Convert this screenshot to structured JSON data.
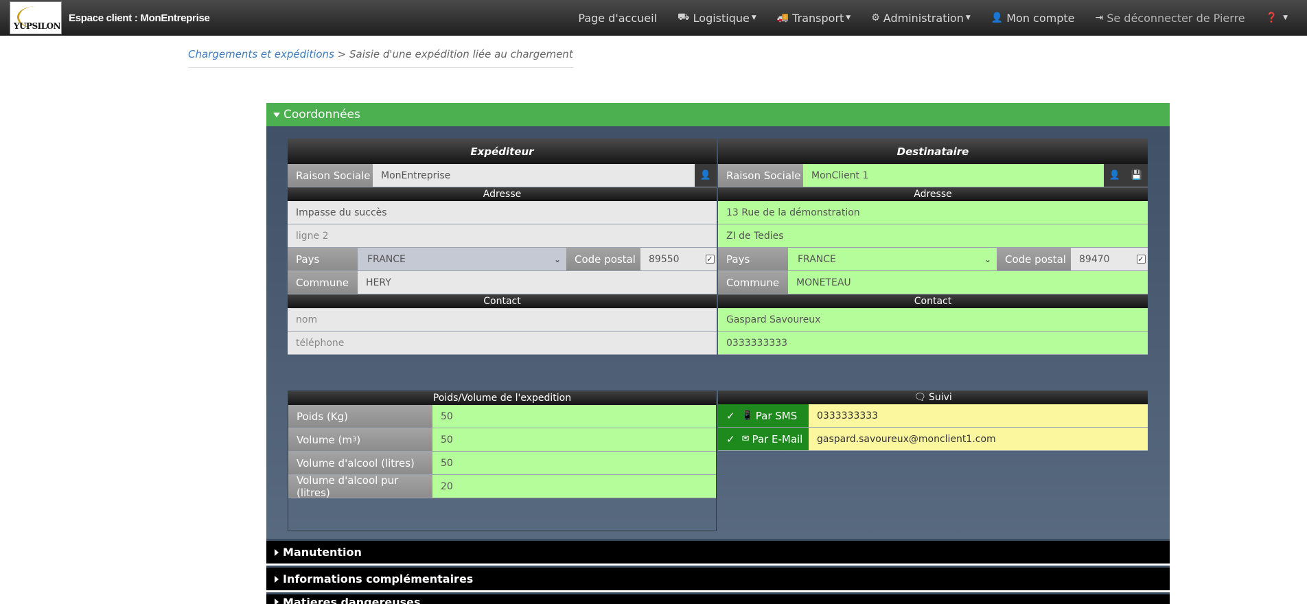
{
  "header": {
    "brand": "Espace client : MonEntreprise",
    "logo_word": "YUPSILON",
    "nav": {
      "home": "Page d'accueil",
      "logistique": "Logistique",
      "transport": "Transport",
      "administration": "Administration",
      "account": "Mon compte",
      "logout": "Se déconnecter de Pierre"
    }
  },
  "breadcrumb": {
    "parent": "Chargements et expéditions",
    "separator": ">",
    "current": "Saisie d'une expédition liée au chargement"
  },
  "coordonnees": {
    "title": "Coordonnées",
    "expediteur": {
      "title": "Expéditeur",
      "raison_sociale_label": "Raison Sociale",
      "raison_sociale": "MonEntreprise",
      "adresse_label": "Adresse",
      "adresse1": "Impasse du succès",
      "adresse2_placeholder": "ligne 2",
      "pays_label": "Pays",
      "pays": "FRANCE",
      "cp_label": "Code postal",
      "cp": "89550",
      "commune_label": "Commune",
      "commune": "HERY",
      "contact_label": "Contact",
      "nom_placeholder": "nom",
      "tel_placeholder": "téléphone"
    },
    "destinataire": {
      "title": "Destinataire",
      "raison_sociale_label": "Raison Sociale",
      "raison_sociale": "MonClient 1",
      "adresse_label": "Adresse",
      "adresse1": "13 Rue de la démonstration",
      "adresse2": "ZI de Tedies",
      "pays_label": "Pays",
      "pays": "FRANCE",
      "cp_label": "Code postal",
      "cp": "89470",
      "commune_label": "Commune",
      "commune": "MONETEAU",
      "contact_label": "Contact",
      "nom": "Gaspard Savoureux",
      "tel": "0333333333"
    },
    "poids": {
      "title": "Poids/Volume de l'expedition",
      "poids_label": "Poids (Kg)",
      "poids": "50",
      "volume_label": "Volume (m",
      "volume_sup": "3",
      "volume_close": ")",
      "volume": "50",
      "alcool_label": "Volume d'alcool (litres)",
      "alcool": "50",
      "alcool_pur_label": "Volume d'alcool pur (litres)",
      "alcool_pur": "20"
    },
    "suivi": {
      "title": "Suivi",
      "sms_label": "Par SMS",
      "sms": "0333333333",
      "email_label": "Par E-Mail",
      "email": "gaspard.savoureux@monclient1.com"
    }
  },
  "sections": {
    "manutention": "Manutention",
    "infos": "Informations complémentaires",
    "matieres": "Matieres dangereuses"
  }
}
